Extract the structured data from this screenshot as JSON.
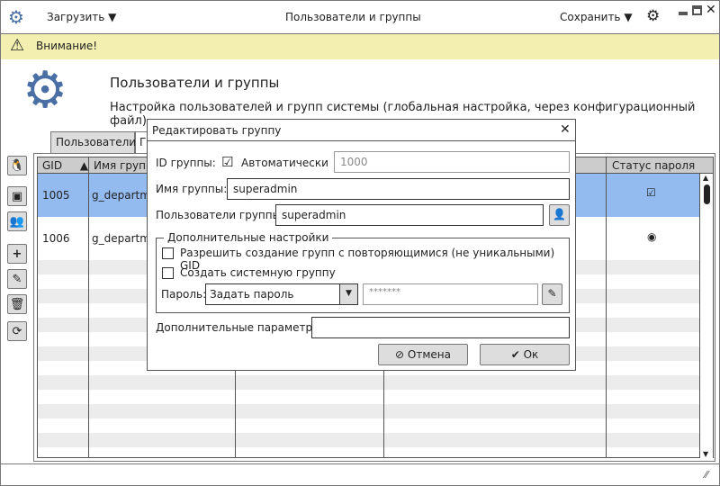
{
  "titlebar": {
    "load_label": "Загрузить",
    "title": "Пользователи и группы",
    "save_label": "Сохранить"
  },
  "warning": {
    "text": "Внимание!"
  },
  "header": {
    "title": "Пользователи и группы",
    "subtitle": "Настройка пользователей и групп системы (глобальная настройка, через конфигурационный файл)"
  },
  "tabs": [
    {
      "label": "Пользователи"
    },
    {
      "label": "Г"
    }
  ],
  "table": {
    "columns": [
      "GID",
      "Имя группы",
      "",
      "",
      "Статус пароля"
    ],
    "rows": [
      {
        "gid": "1005",
        "name": "g_departm",
        "status": "checkbox"
      },
      {
        "gid": "1006",
        "name": "g_departm",
        "status": "radio"
      }
    ]
  },
  "dialog": {
    "title": "Редактировать группу",
    "gid_label": "ID группы:",
    "auto_label": "Автоматически",
    "gid_value": "1000",
    "name_label": "Имя группы:",
    "name_value": "superadmin",
    "users_label": "Пользователи группы:",
    "users_value": "superadmin",
    "extra_legend": "Дополнительные настройки",
    "dup_gid_label": "Разрешить создание групп с повторяющимися (не уникальными) GID",
    "system_label": "Создать системную группу",
    "password_label": "Пароль:",
    "password_mode": "Задать пароль",
    "password_value": "*******",
    "params_label": "Дополнительные параметры:",
    "params_value": "",
    "cancel_label": "Отмена",
    "ok_label": "Ок"
  }
}
